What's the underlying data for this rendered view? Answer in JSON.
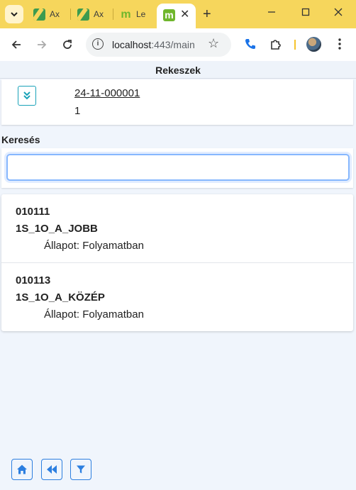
{
  "browser": {
    "tabs": [
      {
        "label": "Ax"
      },
      {
        "label": "Ax"
      },
      {
        "label": "Le"
      }
    ],
    "active_tab_close": "✕",
    "new_tab": "+",
    "url_host": "localhost",
    "url_rest": ":443/main"
  },
  "app": {
    "title": "Rekeszek",
    "rekesz": {
      "code": "24-11-000001",
      "count": "1"
    },
    "search": {
      "label": "Keresés",
      "value": "",
      "placeholder": ""
    },
    "items": [
      {
        "id": "010111",
        "name": "1S_1O_A_JOBB",
        "status": "Állapot: Folyamatban"
      },
      {
        "id": "010113",
        "name": "1S_1O_A_KÖZÉP",
        "status": "Állapot: Folyamatban"
      }
    ]
  },
  "colors": {
    "tabstrip": "#f6d65c",
    "accent": "#2d7fe0",
    "teal": "#19a2b8",
    "background": "#f0f5fc"
  }
}
